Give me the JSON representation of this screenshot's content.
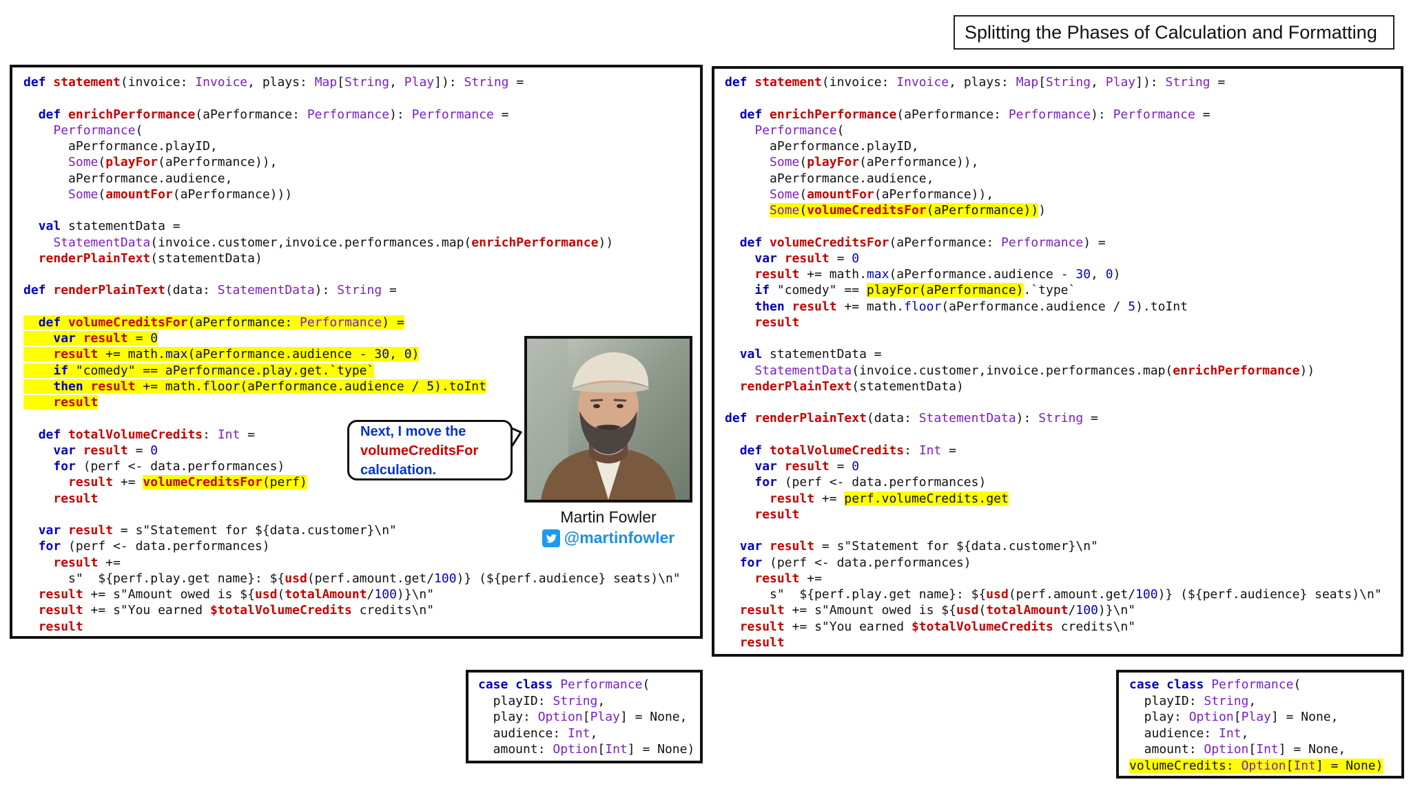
{
  "title": "Splitting the Phases of Calculation and Formatting",
  "author": {
    "name": "Martin Fowler",
    "handle": "@martinfowler"
  },
  "bubble": {
    "line1": "Next, I move the",
    "line2": "volumeCreditsFor",
    "line3": "calculation."
  },
  "colors": {
    "keyword": "#0000c0",
    "function": "#c80000",
    "type": "#7a1fc2",
    "highlight": "#ffff00"
  },
  "icons": [
    "twitter-bird-icon"
  ],
  "left_code": [
    [
      [
        "k",
        "def "
      ],
      [
        "fn",
        "statement"
      ],
      [
        "",
        "(invoice: "
      ],
      [
        "ty",
        "Invoice"
      ],
      [
        "",
        ", plays: "
      ],
      [
        "ty",
        "Map"
      ],
      [
        "",
        "["
      ],
      [
        "ty",
        "String"
      ],
      [
        "",
        ", "
      ],
      [
        "ty",
        "Play"
      ],
      [
        "",
        "]): "
      ],
      [
        "ty",
        "String"
      ],
      [
        "",
        " ="
      ]
    ],
    [],
    [
      [
        "",
        "  "
      ],
      [
        "k",
        "def "
      ],
      [
        "fn",
        "enrichPerformance"
      ],
      [
        "",
        "(aPerformance: "
      ],
      [
        "ty",
        "Performance"
      ],
      [
        "",
        "): "
      ],
      [
        "ty",
        "Performance"
      ],
      [
        "",
        " ="
      ]
    ],
    [
      [
        "",
        "    "
      ],
      [
        "ty",
        "Performance"
      ],
      [
        "",
        "("
      ]
    ],
    [
      [
        "",
        "      aPerformance.playID,"
      ]
    ],
    [
      [
        "",
        "      "
      ],
      [
        "ty",
        "Some"
      ],
      [
        "",
        "("
      ],
      [
        "fn",
        "playFor"
      ],
      [
        "",
        "(aPerformance)),"
      ]
    ],
    [
      [
        "",
        "      aPerformance.audience,"
      ]
    ],
    [
      [
        "",
        "      "
      ],
      [
        "ty",
        "Some"
      ],
      [
        "",
        "("
      ],
      [
        "fn",
        "amountFor"
      ],
      [
        "",
        "(aPerformance)))"
      ]
    ],
    [],
    [
      [
        "",
        "  "
      ],
      [
        "k",
        "val "
      ],
      [
        "",
        "statementData ="
      ]
    ],
    [
      [
        "",
        "    "
      ],
      [
        "ty",
        "StatementData"
      ],
      [
        "",
        "(invoice.customer,invoice.performances.map("
      ],
      [
        "fn",
        "enrichPerformance"
      ],
      [
        "",
        "))"
      ]
    ],
    [
      [
        "",
        "  "
      ],
      [
        "fn",
        "renderPlainText"
      ],
      [
        "",
        "(statementData)"
      ]
    ],
    [],
    [
      [
        "k",
        "def "
      ],
      [
        "fn",
        "renderPlainText"
      ],
      [
        "",
        "(data: "
      ],
      [
        "ty",
        "StatementData"
      ],
      [
        "",
        "): "
      ],
      [
        "ty",
        "String"
      ],
      [
        "",
        " ="
      ]
    ],
    [],
    [
      [
        "hl",
        "  "
      ],
      [
        "hl k",
        "def "
      ],
      [
        "hl fn",
        "volumeCreditsFor"
      ],
      [
        "hl",
        "(aPerformance: "
      ],
      [
        "hl ty",
        "Performance"
      ],
      [
        "hl",
        ") ="
      ]
    ],
    [
      [
        "hl",
        "    "
      ],
      [
        "hl k",
        "var "
      ],
      [
        "hl fn",
        "result"
      ],
      [
        "hl",
        " = "
      ],
      [
        "hl nm",
        "0"
      ]
    ],
    [
      [
        "hl",
        "    "
      ],
      [
        "hl fn",
        "result"
      ],
      [
        "hl",
        " += math."
      ],
      [
        "hl mt",
        "max"
      ],
      [
        "hl",
        "(aPerformance.audience - "
      ],
      [
        "hl nm",
        "30"
      ],
      [
        "hl",
        ", "
      ],
      [
        "hl nm",
        "0"
      ],
      [
        "hl",
        ")"
      ]
    ],
    [
      [
        "hl",
        "    "
      ],
      [
        "hl k",
        "if "
      ],
      [
        "hl",
        "\"comedy\" == aPerformance.play.get.`type`"
      ]
    ],
    [
      [
        "hl",
        "    "
      ],
      [
        "hl k",
        "then "
      ],
      [
        "hl fn",
        "result"
      ],
      [
        "hl",
        " += math."
      ],
      [
        "hl mt",
        "floor"
      ],
      [
        "hl",
        "(aPerformance.audience / "
      ],
      [
        "hl nm",
        "5"
      ],
      [
        "hl",
        ").toInt"
      ]
    ],
    [
      [
        "hl",
        "    "
      ],
      [
        "hl fn",
        "result"
      ]
    ],
    [],
    [
      [
        "",
        "  "
      ],
      [
        "k",
        "def "
      ],
      [
        "fn",
        "totalVolumeCredits"
      ],
      [
        "",
        ": "
      ],
      [
        "ty",
        "Int"
      ],
      [
        "",
        " ="
      ]
    ],
    [
      [
        "",
        "    "
      ],
      [
        "k",
        "var "
      ],
      [
        "fn",
        "result"
      ],
      [
        "",
        " = "
      ],
      [
        "nm",
        "0"
      ]
    ],
    [
      [
        "",
        "    "
      ],
      [
        "k",
        "for "
      ],
      [
        "",
        "(perf <- data.performances)"
      ]
    ],
    [
      [
        "",
        "      "
      ],
      [
        "fn",
        "result"
      ],
      [
        "",
        " += "
      ],
      [
        "hl fn",
        "volumeCreditsFor"
      ],
      [
        "hl",
        "(perf)"
      ]
    ],
    [
      [
        "",
        "    "
      ],
      [
        "fn",
        "result"
      ]
    ],
    [],
    [
      [
        "",
        "  "
      ],
      [
        "k",
        "var "
      ],
      [
        "fn",
        "result"
      ],
      [
        "",
        " = s\"Statement for ${data.customer}\\n\""
      ]
    ],
    [
      [
        "",
        "  "
      ],
      [
        "k",
        "for "
      ],
      [
        "",
        "(perf <- data.performances)"
      ]
    ],
    [
      [
        "",
        "    "
      ],
      [
        "fn",
        "result"
      ],
      [
        "",
        " +="
      ]
    ],
    [
      [
        "",
        "      s\"  ${perf.play.get name}: ${"
      ],
      [
        "fn",
        "usd"
      ],
      [
        "",
        "(perf.amount.get/"
      ],
      [
        "nm",
        "100"
      ],
      [
        "",
        ")} (${perf.audience} seats)\\n\""
      ]
    ],
    [
      [
        "",
        "  "
      ],
      [
        "fn",
        "result"
      ],
      [
        "",
        " += s\"Amount owed is ${"
      ],
      [
        "fn",
        "usd"
      ],
      [
        "",
        "("
      ],
      [
        "fn",
        "totalAmount"
      ],
      [
        "",
        "/"
      ],
      [
        "nm",
        "100"
      ],
      [
        "",
        ")}\\n\""
      ]
    ],
    [
      [
        "",
        "  "
      ],
      [
        "fn",
        "result"
      ],
      [
        "",
        " += s\"You earned "
      ],
      [
        "fn",
        "$totalVolumeCredits"
      ],
      [
        "",
        " credits\\n\""
      ]
    ],
    [
      [
        "",
        "  "
      ],
      [
        "fn",
        "result"
      ]
    ]
  ],
  "right_code": [
    [
      [
        "k",
        "def "
      ],
      [
        "fn",
        "statement"
      ],
      [
        "",
        "(invoice: "
      ],
      [
        "ty",
        "Invoice"
      ],
      [
        "",
        ", plays: "
      ],
      [
        "ty",
        "Map"
      ],
      [
        "",
        "["
      ],
      [
        "ty",
        "String"
      ],
      [
        "",
        ", "
      ],
      [
        "ty",
        "Play"
      ],
      [
        "",
        "]): "
      ],
      [
        "ty",
        "String"
      ],
      [
        "",
        " ="
      ]
    ],
    [],
    [
      [
        "",
        "  "
      ],
      [
        "k",
        "def "
      ],
      [
        "fn",
        "enrichPerformance"
      ],
      [
        "",
        "(aPerformance: "
      ],
      [
        "ty",
        "Performance"
      ],
      [
        "",
        "): "
      ],
      [
        "ty",
        "Performance"
      ],
      [
        "",
        " ="
      ]
    ],
    [
      [
        "",
        "    "
      ],
      [
        "ty",
        "Performance"
      ],
      [
        "",
        "("
      ]
    ],
    [
      [
        "",
        "      aPerformance.playID,"
      ]
    ],
    [
      [
        "",
        "      "
      ],
      [
        "ty",
        "Some"
      ],
      [
        "",
        "("
      ],
      [
        "fn",
        "playFor"
      ],
      [
        "",
        "(aPerformance)),"
      ]
    ],
    [
      [
        "",
        "      aPerformance.audience,"
      ]
    ],
    [
      [
        "",
        "      "
      ],
      [
        "ty",
        "Some"
      ],
      [
        "",
        "("
      ],
      [
        "fn",
        "amountFor"
      ],
      [
        "",
        "(aPerformance)),"
      ]
    ],
    [
      [
        "",
        "      "
      ],
      [
        "hl ty",
        "Some"
      ],
      [
        "hl",
        "("
      ],
      [
        "hl fn",
        "volumeCreditsFor"
      ],
      [
        "hl",
        "(aPerformance))"
      ],
      [
        "",
        ")"
      ]
    ],
    [],
    [
      [
        "",
        "  "
      ],
      [
        "k",
        "def "
      ],
      [
        "fn",
        "volumeCreditsFor"
      ],
      [
        "",
        "(aPerformance: "
      ],
      [
        "ty",
        "Performance"
      ],
      [
        "",
        ") ="
      ]
    ],
    [
      [
        "",
        "    "
      ],
      [
        "k",
        "var "
      ],
      [
        "fn",
        "result"
      ],
      [
        "",
        " = "
      ],
      [
        "nm",
        "0"
      ]
    ],
    [
      [
        "",
        "    "
      ],
      [
        "fn",
        "result"
      ],
      [
        "",
        " += math."
      ],
      [
        "mt",
        "max"
      ],
      [
        "",
        "(aPerformance.audience - "
      ],
      [
        "nm",
        "30"
      ],
      [
        "",
        ", "
      ],
      [
        "nm",
        "0"
      ],
      [
        "",
        ")"
      ]
    ],
    [
      [
        "",
        "    "
      ],
      [
        "k",
        "if "
      ],
      [
        "",
        "\"comedy\" == "
      ],
      [
        "hl",
        "playFor(aPerformance)"
      ],
      [
        "",
        ".`type`"
      ]
    ],
    [
      [
        "",
        "    "
      ],
      [
        "k",
        "then "
      ],
      [
        "fn",
        "result"
      ],
      [
        "",
        " += math."
      ],
      [
        "mt",
        "floor"
      ],
      [
        "",
        "(aPerformance.audience / "
      ],
      [
        "nm",
        "5"
      ],
      [
        "",
        ").toInt"
      ]
    ],
    [
      [
        "",
        "    "
      ],
      [
        "fn",
        "result"
      ]
    ],
    [],
    [
      [
        "",
        "  "
      ],
      [
        "k",
        "val "
      ],
      [
        "",
        "statementData ="
      ]
    ],
    [
      [
        "",
        "    "
      ],
      [
        "ty",
        "StatementData"
      ],
      [
        "",
        "(invoice.customer,invoice.performances.map("
      ],
      [
        "fn",
        "enrichPerformance"
      ],
      [
        "",
        "))"
      ]
    ],
    [
      [
        "",
        "  "
      ],
      [
        "fn",
        "renderPlainText"
      ],
      [
        "",
        "(statementData)"
      ]
    ],
    [],
    [
      [
        "k",
        "def "
      ],
      [
        "fn",
        "renderPlainText"
      ],
      [
        "",
        "(data: "
      ],
      [
        "ty",
        "StatementData"
      ],
      [
        "",
        "): "
      ],
      [
        "ty",
        "String"
      ],
      [
        "",
        " ="
      ]
    ],
    [],
    [
      [
        "",
        "  "
      ],
      [
        "k",
        "def "
      ],
      [
        "fn",
        "totalVolumeCredits"
      ],
      [
        "",
        ": "
      ],
      [
        "ty",
        "Int"
      ],
      [
        "",
        " ="
      ]
    ],
    [
      [
        "",
        "    "
      ],
      [
        "k",
        "var "
      ],
      [
        "fn",
        "result"
      ],
      [
        "",
        " = "
      ],
      [
        "nm",
        "0"
      ]
    ],
    [
      [
        "",
        "    "
      ],
      [
        "k",
        "for "
      ],
      [
        "",
        "(perf <- data.performances)"
      ]
    ],
    [
      [
        "",
        "      "
      ],
      [
        "fn",
        "result"
      ],
      [
        "",
        " += "
      ],
      [
        "hl",
        "perf.volumeCredits.get"
      ]
    ],
    [
      [
        "",
        "    "
      ],
      [
        "fn",
        "result"
      ]
    ],
    [],
    [
      [
        "",
        "  "
      ],
      [
        "k",
        "var "
      ],
      [
        "fn",
        "result"
      ],
      [
        "",
        " = s\"Statement for ${data.customer}\\n\""
      ]
    ],
    [
      [
        "",
        "  "
      ],
      [
        "k",
        "for "
      ],
      [
        "",
        "(perf <- data.performances)"
      ]
    ],
    [
      [
        "",
        "    "
      ],
      [
        "fn",
        "result"
      ],
      [
        "",
        " +="
      ]
    ],
    [
      [
        "",
        "      s\"  ${perf.play.get name}: ${"
      ],
      [
        "fn",
        "usd"
      ],
      [
        "",
        "(perf.amount.get/"
      ],
      [
        "nm",
        "100"
      ],
      [
        "",
        ")} (${perf.audience} seats)\\n\""
      ]
    ],
    [
      [
        "",
        "  "
      ],
      [
        "fn",
        "result"
      ],
      [
        "",
        " += s\"Amount owed is ${"
      ],
      [
        "fn",
        "usd"
      ],
      [
        "",
        "("
      ],
      [
        "fn",
        "totalAmount"
      ],
      [
        "",
        "/"
      ],
      [
        "nm",
        "100"
      ],
      [
        "",
        ")}\\n\""
      ]
    ],
    [
      [
        "",
        "  "
      ],
      [
        "fn",
        "result"
      ],
      [
        "",
        " += s\"You earned "
      ],
      [
        "fn",
        "$totalVolumeCredits"
      ],
      [
        "",
        " credits\\n\""
      ]
    ],
    [
      [
        "",
        "  "
      ],
      [
        "fn",
        "result"
      ]
    ]
  ],
  "left_case": [
    [
      [
        "k",
        "case class "
      ],
      [
        "ty",
        "Performance"
      ],
      [
        "",
        "("
      ]
    ],
    [
      [
        "",
        "  playID: "
      ],
      [
        "ty",
        "String"
      ],
      [
        "",
        ","
      ]
    ],
    [
      [
        "",
        "  play: "
      ],
      [
        "ty",
        "Option"
      ],
      [
        "",
        "["
      ],
      [
        "ty",
        "Play"
      ],
      [
        "",
        "] = None,"
      ]
    ],
    [
      [
        "",
        "  audience: "
      ],
      [
        "ty",
        "Int"
      ],
      [
        "",
        ","
      ]
    ],
    [
      [
        "",
        "  amount: "
      ],
      [
        "ty",
        "Option"
      ],
      [
        "",
        "["
      ],
      [
        "ty",
        "Int"
      ],
      [
        "",
        "] = None)"
      ]
    ]
  ],
  "right_case": [
    [
      [
        "k",
        "case class "
      ],
      [
        "ty",
        "Performance"
      ],
      [
        "",
        "("
      ]
    ],
    [
      [
        "",
        "  playID: "
      ],
      [
        "ty",
        "String"
      ],
      [
        "",
        ","
      ]
    ],
    [
      [
        "",
        "  play: "
      ],
      [
        "ty",
        "Option"
      ],
      [
        "",
        "["
      ],
      [
        "ty",
        "Play"
      ],
      [
        "",
        "] = None,"
      ]
    ],
    [
      [
        "",
        "  audience: "
      ],
      [
        "ty",
        "Int"
      ],
      [
        "",
        ","
      ]
    ],
    [
      [
        "",
        "  amount: "
      ],
      [
        "ty",
        "Option"
      ],
      [
        "",
        "["
      ],
      [
        "ty",
        "Int"
      ],
      [
        "",
        "] = None,"
      ]
    ],
    [
      [
        "hl",
        "volumeCredits: "
      ],
      [
        "hl ty",
        "Option"
      ],
      [
        "hl",
        "["
      ],
      [
        "hl ty",
        "Int"
      ],
      [
        "hl",
        "] = None)"
      ]
    ]
  ]
}
